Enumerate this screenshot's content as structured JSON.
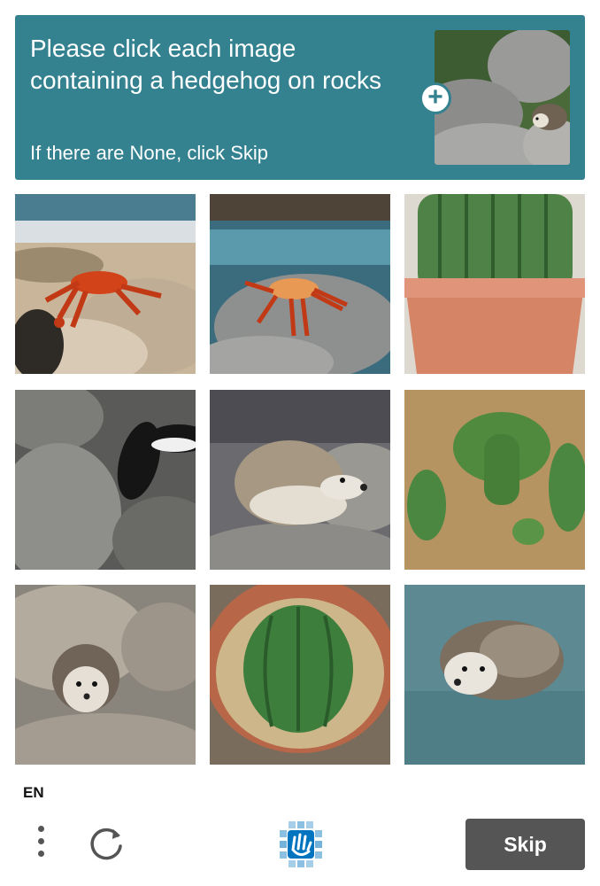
{
  "header": {
    "prompt": "Please click each image containing a hedgehog on rocks",
    "subtext": "If there are None, click Skip",
    "example_icon": "plus-icon"
  },
  "tiles": [
    {
      "subject": "crab on rocks"
    },
    {
      "subject": "crab on rock by water"
    },
    {
      "subject": "cactus in pot"
    },
    {
      "subject": "penguin on rocks"
    },
    {
      "subject": "hedgehog on rocks"
    },
    {
      "subject": "cactus in sand"
    },
    {
      "subject": "hedgehog on rocks"
    },
    {
      "subject": "cactus in pot"
    },
    {
      "subject": "hedgehog in water"
    }
  ],
  "footer": {
    "language": "EN",
    "skip_label": "Skip",
    "menu_icon": "more-vertical-icon",
    "refresh_icon": "refresh-icon",
    "logo_icon": "hcaptcha-logo-icon"
  },
  "colors": {
    "accent": "#348190",
    "button": "#555555"
  }
}
